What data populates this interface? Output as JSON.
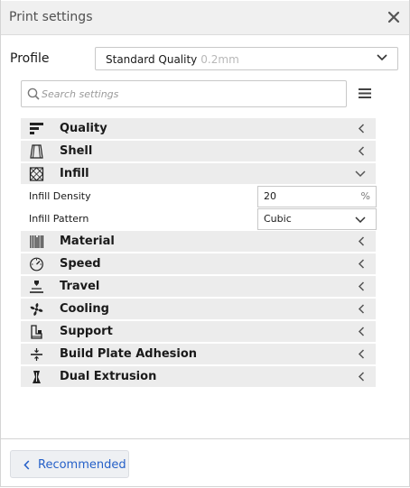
{
  "window": {
    "title": "Print settings",
    "close_icon": "close-icon"
  },
  "profile": {
    "label": "Profile",
    "value": "Standard Quality",
    "layer_height": "0.2mm"
  },
  "search": {
    "placeholder": "Search settings"
  },
  "categories": [
    {
      "label": "Quality",
      "icon": "quality-icon",
      "expanded": false
    },
    {
      "label": "Shell",
      "icon": "shell-icon",
      "expanded": false
    },
    {
      "label": "Infill",
      "icon": "infill-icon",
      "expanded": true
    },
    {
      "label": "Material",
      "icon": "material-icon",
      "expanded": false
    },
    {
      "label": "Speed",
      "icon": "speed-icon",
      "expanded": false
    },
    {
      "label": "Travel",
      "icon": "travel-icon",
      "expanded": false
    },
    {
      "label": "Cooling",
      "icon": "cooling-icon",
      "expanded": false
    },
    {
      "label": "Support",
      "icon": "support-icon",
      "expanded": false
    },
    {
      "label": "Build Plate Adhesion",
      "icon": "build-plate-adhesion-icon",
      "expanded": false
    },
    {
      "label": "Dual Extrusion",
      "icon": "dual-extrusion-icon",
      "expanded": false
    }
  ],
  "infill": {
    "density": {
      "label": "Infill Density",
      "value": "20",
      "unit": "%"
    },
    "pattern": {
      "label": "Infill Pattern",
      "value": "Cubic"
    }
  },
  "footer": {
    "recommended_label": "Recommended"
  },
  "colors": {
    "accent": "#2560c8",
    "category_bg": "#ececec",
    "titlebar_bg": "#f0f0f0"
  }
}
